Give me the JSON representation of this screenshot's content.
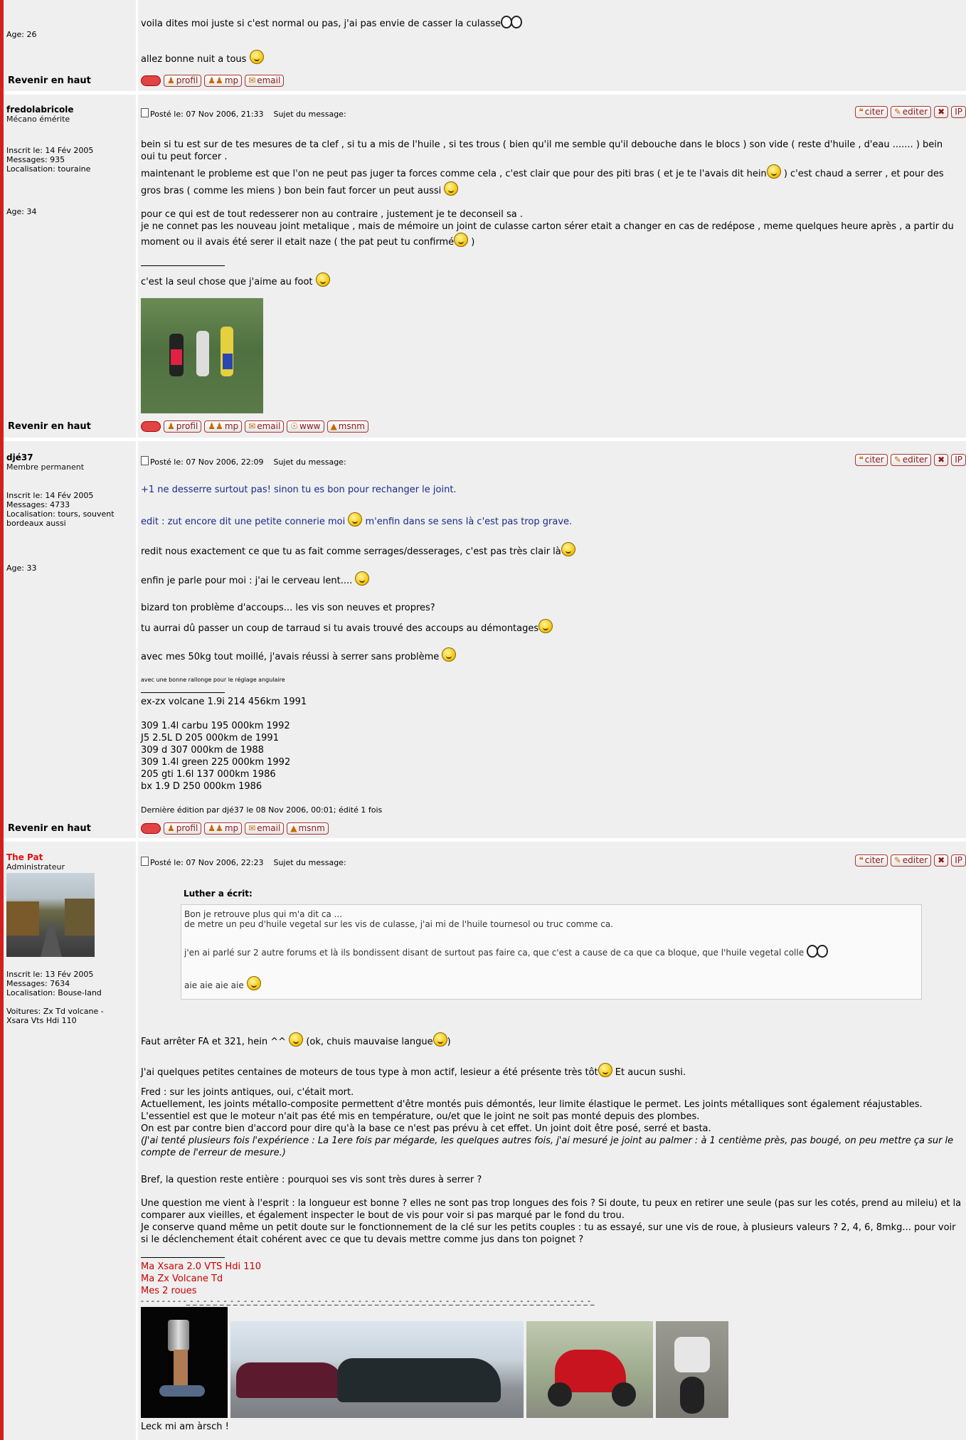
{
  "common": {
    "revenir": "Revenir en haut",
    "profil": "profil",
    "mp": "mp",
    "email": "email",
    "www": "www",
    "msnm": "msnm",
    "citer": "citer",
    "editer": "editer",
    "ip": "IP",
    "posted_prefix": "Posté le:",
    "subject": "Sujet du message:"
  },
  "post0": {
    "age": "Age: 26",
    "line1": "voila dites moi juste si c'est normal ou pas, j'ai pas envie de casser la culasse",
    "line2": "allez bonne nuit a tous"
  },
  "post1": {
    "username": "fredolabricole",
    "rank": "Mécano émérite",
    "joined": "Inscrit le: 14 Fév 2005",
    "messages": "Messages: 935",
    "location": "Localisation: touraine",
    "age": "Age: 34",
    "date": "07 Nov 2006, 21:33",
    "p1": "bein si tu est sur de tes mesures de ta clef , si tu a mis de l'huile , si tes trous ( bien qu'il me semble qu'il debouche dans le blocs ) son vide ( reste d'huile , d'eau ....... ) bein oui tu peut forcer .",
    "p2a": "maintenant le probleme est que l'on ne peut pas juger ta forces comme cela , c'est clair que pour des piti bras ( et je te l'avais dit hein",
    "p2b": ") c'est chaud a serrer , et pour des gros bras ( comme les miens ) bon bein faut forcer un peut aussi",
    "p3a": "pour ce qui est de tout redesserer non au contraire , justement je te deconseil sa .",
    "p3b": "je ne connet pas les nouveau joint metalique , mais de mémoire un joint de culasse carton sérer etait a changer en cas de redépose , meme quelques heure après , a partir du moment ou il avais été serer il etait naze ( the pat peut tu confirmé",
    "p3c": ")",
    "sig": "c'est la seul chose que j'aime au foot"
  },
  "post2": {
    "username": "djé37",
    "rank": "Membre permanent",
    "joined": "Inscrit le: 14 Fév 2005",
    "messages": "Messages: 4733",
    "location": "Localisation: tours, souvent bordeaux aussi",
    "age": "Age: 33",
    "date": "07 Nov 2006, 22:09",
    "l1": "+1 ne desserre surtout pas! sinon tu es bon pour rechanger le joint.",
    "l2a": "edit : zut encore dit une petite connerie moi",
    "l2b": "m'enfin dans se sens là c'est pas trop grave.",
    "l3": "redit nous exactement ce que tu as fait comme serrages/desserages, c'est pas très clair là",
    "l4": "enfin je parle pour moi : j'ai le cerveau lent....",
    "l5": "bizard ton problème d'accoups... les vis son neuves et propres?",
    "l6": "tu aurrai dû passer un coup de tarraud si tu avais trouvé des accoups au démontages",
    "l7": "avec mes 50kg tout moillé, j'avais réussi à serrer sans problème",
    "l8": "avec une bonne rallonge pour le réglage angulaire",
    "sig": [
      "ex-zx volcane 1.9i 214 456km 1991",
      "",
      "309 1.4l carbu 195 000km 1992",
      "J5 2.5L D 205 000km de 1991",
      "309 d 307 000km de 1988",
      "309 1.4l green 225 000km 1992",
      "205 gti 1.6l 137 000km 1986",
      "bx 1.9 D 250 000km 1986"
    ],
    "edited": "Dernière édition par djé37 le 08 Nov 2006, 00:01; édité 1 fois"
  },
  "post3": {
    "username": "The Pat",
    "rank": "Administrateur",
    "joined": "Inscrit le: 13 Fév 2005",
    "messages": "Messages: 7634",
    "location": "Localisation: Bouse-land",
    "cars": "Voitures: Zx Td volcane - Xsara Vts Hdi 110",
    "date": "07 Nov 2006, 22:23",
    "quote_author": "Luther a écrit:",
    "q1": "Bon je retrouve plus qui m'a dit ca ...",
    "q2": "de metre un peu d'huile vegetal sur les vis de culasse, j'ai mi de l'huile tournesol ou truc comme ca.",
    "q3": "j'en ai parlé sur 2 autre forums et là ils bondissent disant de surtout pas faire ca, que c'est a cause de ca que ca bloque, que l'huile vegetal colle",
    "q4": "aie aie aie aie",
    "r1a": "Faut arrêter FA et 321, hein ^^",
    "r1b": "(ok, chuis mauvaise langue",
    "r1c": ")",
    "r2a": "J'ai quelques petites centaines de moteurs de tous type à mon actif, lesieur a été présente très tôt",
    "r2b": "Et aucun sushi.",
    "r3": "Fred : sur les joints antiques, oui, c'était mort.",
    "r4": "Actuellement, les joints métallo-composite permettent d'être montés puis démontés, leur limite élastique le permet. Les joints métalliques sont également réajustables. L'essentiel est que le moteur n'ait pas été mis en température, ou/et que le joint ne soit pas monté depuis des plombes.",
    "r5": "On est par contre bien d'accord pour dire qu'à la base ce n'est pas prévu à cet effet. Un joint doit être posé, serré et basta.",
    "r6": "(J'ai tenté plusieurs fois l'expérience : La 1ere fois par mégarde, les quelques autres fois, j'ai mesuré je joint au palmer : à 1 centième près, pas bougé, on peu mettre ça sur le compte de l'erreur de mesure.)",
    "r7": "Bref, la question reste entière : pourquoi ses vis sont très dures à serrer ?",
    "r8": "Une question me vient à l'esprit : la longueur est bonne ? elles ne sont pas trop longues des fois ? Si doute, tu peux en retirer une seule (pas sur les cotés, prend au mileiu) et la comparer aux vieilles, et également inspecter le bout de vis pour voir si pas marqué par le fond du trou.",
    "r9": "Je conserve quand même un petit doute sur le fonctionnement de la clé sur les petits couples : tu as essayé, sur une vis de roue, à plusieurs valeurs ? 2, 4, 6, 8mkg... pour voir si le déclenchement était cohérent avec ce que tu devais mettre comme jus dans ton poignet ?",
    "sig1": "Ma Xsara 2.0 VTS Hdi 110",
    "sig2": "Ma Zx Volcane Td",
    "sig3": "Mes 2 roues",
    "dashes": "- - - - - - - - -_-_-_-_-_-_-_-_-_-_-_-_-_-_-_-_-_-_-_-_-_-_-_-_-_-_-_-_-_-_-_-_-_-_-_-_-_-_-_-_-_-_-_-_-_-_-_-_-_-_-_-_-_-_-_-_-_-_-_-_-_",
    "tagline": "Leck mi am àrsch !"
  }
}
